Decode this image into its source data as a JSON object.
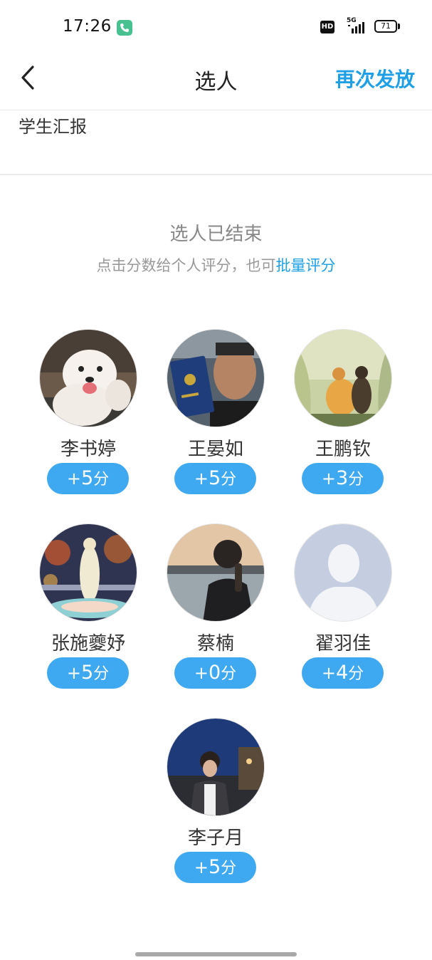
{
  "status_bar": {
    "time": "17:26",
    "hd": "HD",
    "network": "5G",
    "battery": "71"
  },
  "nav": {
    "title": "选人",
    "action": "再次发放"
  },
  "activity_name": "学生汇报",
  "banner": {
    "title": "选人已结束",
    "hint_prefix": "点击分数给个人评分，也可",
    "hint_link": "批量评分"
  },
  "score_unit": "分",
  "students": [
    {
      "name": "李书婷",
      "score": "5",
      "avatar": "dog-photo"
    },
    {
      "name": "王晏如",
      "score": "5",
      "avatar": "man-with-certificate-photo"
    },
    {
      "name": "王鹏钦",
      "score": "3",
      "avatar": "painting-two-figures"
    },
    {
      "name": "张施夔妤",
      "score": "5",
      "avatar": "fountain-statue-photo"
    },
    {
      "name": "蔡楠",
      "score": "0",
      "avatar": "man-by-water-photo"
    },
    {
      "name": "翟羽佳",
      "score": "4",
      "avatar": "default-avatar-icon"
    },
    {
      "name": "李子月",
      "score": "5",
      "avatar": "man-night-street-photo"
    }
  ],
  "colors": {
    "accent": "#1e9fe6",
    "score_button": "#3ea8f0",
    "call_icon": "#46c18f"
  }
}
